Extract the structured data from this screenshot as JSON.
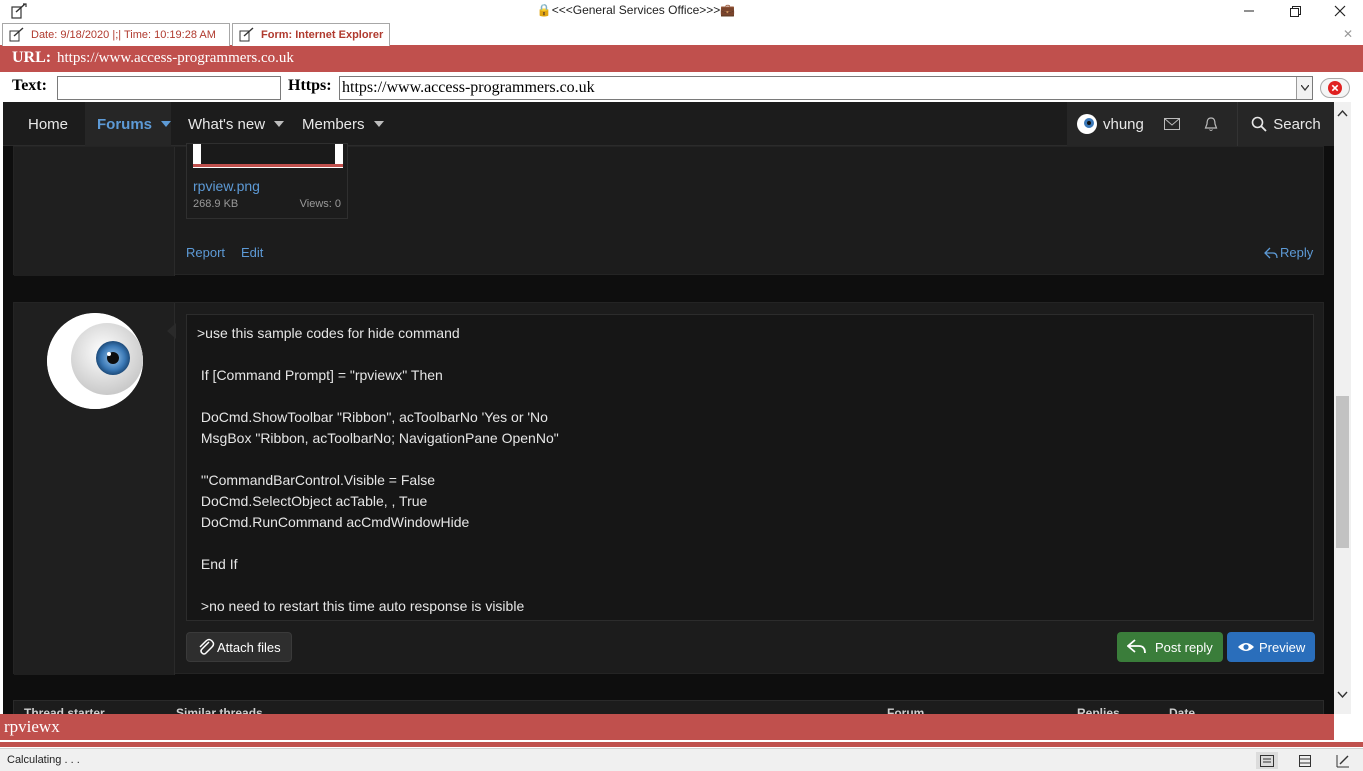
{
  "window": {
    "title": "🔒<<<General Services Office>>>💼"
  },
  "tabs": [
    {
      "label": "Date: 9/18/2020 |;| Time: 10:19:28 AM"
    },
    {
      "label": "Form: Internet Explorer"
    }
  ],
  "urlbar": {
    "label": "URL:",
    "value": "https://www.access-programmers.co.uk"
  },
  "inputs": {
    "text_label": "Text:",
    "text_value": "",
    "https_label": "Https:",
    "https_value": "https://www.access-programmers.co.uk"
  },
  "nav": {
    "home": "Home",
    "forums": "Forums",
    "whats_new": "What's new",
    "members": "Members",
    "user": "vhung",
    "search": "Search"
  },
  "post1": {
    "attachment_name": "rpview.png",
    "attachment_size": "268.9 KB",
    "attachment_views": "Views: 0",
    "report": "Report",
    "edit": "Edit",
    "reply": "Reply"
  },
  "editor": {
    "lines": [
      ">use this sample codes for hide command",
      "",
      " If [Command Prompt] = \"rpviewx\" Then",
      "",
      " DoCmd.ShowToolbar \"Ribbon\", acToolbarNo 'Yes or 'No",
      " MsgBox \"Ribbon, acToolbarNo; NavigationPane OpenNo\"",
      "",
      " '\"CommandBarControl.Visible = False",
      " DoCmd.SelectObject acTable, , True",
      " DoCmd.RunCommand acCmdWindowHide",
      "",
      " End If",
      "",
      " >no need to restart this time auto response is visible"
    ],
    "attach_files": "Attach files",
    "post_reply": "Post reply",
    "preview": "Preview"
  },
  "table_head": {
    "thread_starter": "Thread starter",
    "similar_threads": "Similar threads",
    "forum": "Forum",
    "replies": "Replies",
    "date": "Date"
  },
  "command_text": "rpviewx",
  "status": {
    "text": "Calculating . . ."
  },
  "colors": {
    "accent_red": "#c0504d",
    "link_blue": "#5d9ad6",
    "post_reply_green": "#3a7d3a",
    "preview_blue": "#2a6ebb"
  }
}
